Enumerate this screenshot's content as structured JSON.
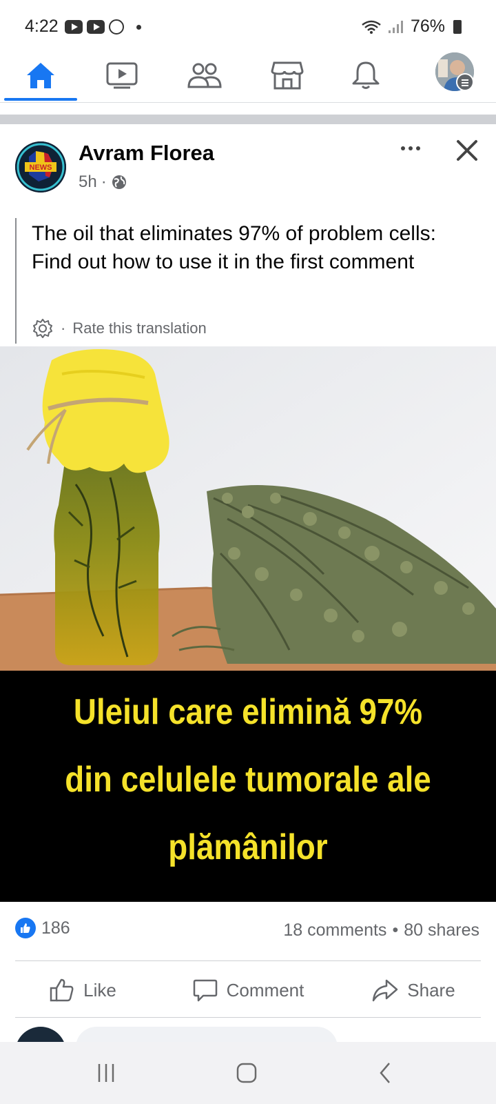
{
  "status_bar": {
    "time": "4:22",
    "battery": "76%"
  },
  "nav": {
    "tabs": [
      {
        "name": "home",
        "icon": "home-icon",
        "active": true
      },
      {
        "name": "watch",
        "icon": "video-icon",
        "active": false
      },
      {
        "name": "friends",
        "icon": "friends-icon",
        "active": false
      },
      {
        "name": "marketplace",
        "icon": "marketplace-icon",
        "active": false
      },
      {
        "name": "notifications",
        "icon": "bell-icon",
        "active": false
      },
      {
        "name": "menu",
        "icon": "profile-avatar",
        "active": false
      }
    ],
    "accent_color": "#1877f2"
  },
  "post": {
    "author": "Avram Florea",
    "avatar_badge": "NEWS",
    "time": "5h",
    "audience_icon": "globe-icon",
    "text": "The oil that eliminates 97% of problem cells: Find out how to use it in the first comment",
    "translation_prompt": "Rate this translation",
    "image_caption_lines": [
      "Uleiul care elimină 97%",
      "din celulele tumorale ale",
      "plămânilor"
    ],
    "caption_color": "#f5e22a",
    "reaction_count": "186",
    "comments": "18 comments",
    "shares": "80 shares",
    "actions": {
      "like": "Like",
      "comment": "Comment",
      "share": "Share"
    }
  }
}
